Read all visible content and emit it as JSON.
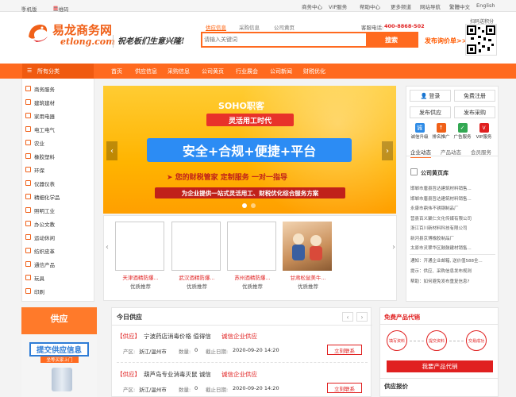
{
  "topbar": {
    "mobile": "手机版",
    "qrcode": "二维码",
    "links": [
      "商务中心",
      "VIP服务",
      "帮助中心",
      "更多频道",
      "网站导航",
      "繁體中文",
      "English"
    ]
  },
  "header": {
    "logo_cn": "易龙商务网",
    "logo_en": "etlong.com",
    "slogan": "祝老板们生意兴隆!",
    "search_tabs": [
      "供应信息",
      "采购信息",
      "公司黄页"
    ],
    "search_placeholder": "请输入关键词",
    "search_button": "搜索",
    "hotline_label": "客服电话:",
    "hotline": "400-8868-502",
    "publish": "发布询价单>>",
    "qr_label": "扫码送积分"
  },
  "nav": {
    "categories": "所有分类",
    "items": [
      "首页",
      "供应信息",
      "采购信息",
      "公司黄页",
      "行业展会",
      "公司新闻",
      "财税优化"
    ]
  },
  "sidebar": [
    "商务服务",
    "建筑建材",
    "家用电器",
    "电工电气",
    "农业",
    "橡胶塑料",
    "环保",
    "仪器仪表",
    "精细化学品",
    "照明工业",
    "办公文教",
    "运动休闲",
    "纺织皮革",
    "通信产品",
    "玩具",
    "印刷"
  ],
  "banner": {
    "brand": "SOHO职客",
    "sub": "灵活用工时代",
    "main": "安全+合规+便捷+平台",
    "line1": "➤ 您的财税管家  定制服务  一对一指导",
    "line2": "为企业提供一站式灵活用工、财税优化综合服务方案"
  },
  "products": [
    {
      "name": "天津酒精防爆...",
      "tag": "优质推荐"
    },
    {
      "name": "武汉酒精防爆...",
      "tag": "优质推荐"
    },
    {
      "name": "苏州酒精防爆...",
      "tag": "优质推荐"
    },
    {
      "name": "甘肃松鼠美牛...",
      "tag": "优质推荐"
    }
  ],
  "right": {
    "login": "登录",
    "register": "免费注册",
    "publish_supply": "发布供应",
    "publish_buy": "发布采购",
    "icons": [
      "诚信升级",
      "排名推广",
      "广告服务",
      "VIP服务"
    ],
    "tabs": [
      "企业动态",
      "产品动态",
      "会员服务"
    ],
    "yellow_pages": "公司黄页库",
    "companies": [
      "邯郸市唐县旨达建筑材料销售...",
      "邯郸市唐县旨达建筑材料销售...",
      "永康市鼎伟不锈钢制品厂",
      "营县百义聚仁文化传媒有限公司",
      "浙江百川新材料科技有限公司",
      "新河县京博橡胶制品厂",
      "太原市灵翠华区鼓鼓建材销售..."
    ],
    "notices": [
      "通知：开通企业邮箱, 送价值588全...",
      "提示：供应、采购信息发布规则",
      "帮助：如何避免发布重复信息?"
    ]
  },
  "lower": {
    "promo_title": "供应",
    "promo_text": "提交供应信息",
    "promo_sub": "坐等买家上门",
    "today_title": "今日供应",
    "listings": [
      {
        "tag": "【供应】",
        "title": "宁波药店消毒价格 值得信",
        "badge": "诚信企业供应",
        "origin_label": "产区:",
        "origin": "浙江/温州市",
        "qty_label": "数量:",
        "qty": "0",
        "date_label": "截止日期:",
        "date": "2020-09-20 14:20",
        "btn": "立刻联系"
      },
      {
        "tag": "【供应】",
        "title": "葫芦岛专业消毒灭鼠 诚信",
        "badge": "诚信企业供应",
        "origin_label": "产区:",
        "origin": "浙江/温州市",
        "qty_label": "数量:",
        "qty": "0",
        "date_label": "截止日期:",
        "date": "2020-09-20 14:20",
        "btn": "立刻联系"
      }
    ],
    "free_title": "免费产品代销",
    "steps": [
      "填写资料",
      "提交资料",
      "交易成功"
    ],
    "agent_btn": "我要产品代销",
    "price_title": "供应报价"
  },
  "colors": {
    "accent": "#ff6a1f",
    "brand": "#f06018",
    "red": "#e02020"
  }
}
